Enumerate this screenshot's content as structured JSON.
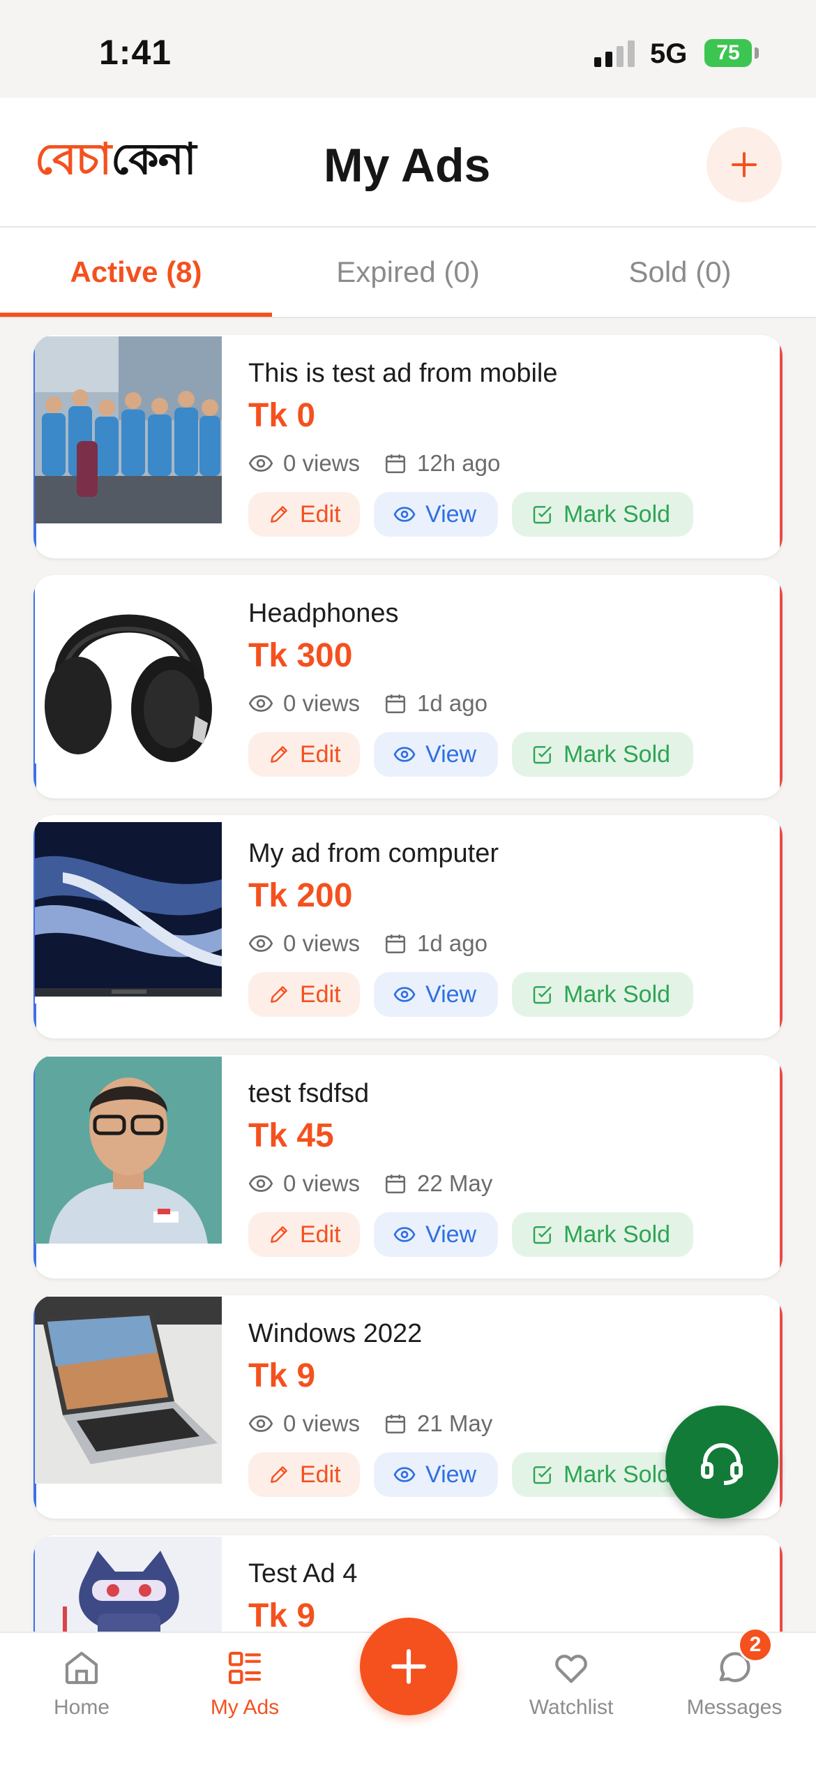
{
  "status_bar": {
    "time": "1:41",
    "network": "5G",
    "battery": "75"
  },
  "header": {
    "logo_part_a": "বেচা",
    "logo_part_b": "কেনা",
    "title": "My Ads"
  },
  "tabs": [
    {
      "label": "Active (8)",
      "active": true
    },
    {
      "label": "Expired (0)",
      "active": false
    },
    {
      "label": "Sold (0)",
      "active": false
    }
  ],
  "ads": [
    {
      "title": "This is test ad from mobile",
      "price": "Tk 0",
      "views": "0 views",
      "date": "12h ago",
      "edit": "Edit",
      "view": "View",
      "mark_sold": "Mark Sold"
    },
    {
      "title": "Headphones",
      "price": "Tk 300",
      "views": "0 views",
      "date": "1d ago",
      "edit": "Edit",
      "view": "View",
      "mark_sold": "Mark Sold"
    },
    {
      "title": "My ad from computer",
      "price": "Tk 200",
      "views": "0 views",
      "date": "1d ago",
      "edit": "Edit",
      "view": "View",
      "mark_sold": "Mark Sold"
    },
    {
      "title": "test fsdfsd",
      "price": "Tk 45",
      "views": "0 views",
      "date": "22 May",
      "edit": "Edit",
      "view": "View",
      "mark_sold": "Mark Sold"
    },
    {
      "title": "Windows 2022",
      "price": "Tk 9",
      "views": "0 views",
      "date": "21 May",
      "edit": "Edit",
      "view": "View",
      "mark_sold": "Mark Sold"
    },
    {
      "title": "Test Ad 4",
      "price": "Tk 9"
    }
  ],
  "bottom_nav": {
    "home": "Home",
    "my_ads": "My Ads",
    "watchlist": "Watchlist",
    "messages": "Messages",
    "messages_badge": "2"
  },
  "colors": {
    "accent": "#f4511e",
    "view_blue": "#2f6fe0",
    "sold_green": "#2ea453",
    "support_green": "#137b38"
  }
}
